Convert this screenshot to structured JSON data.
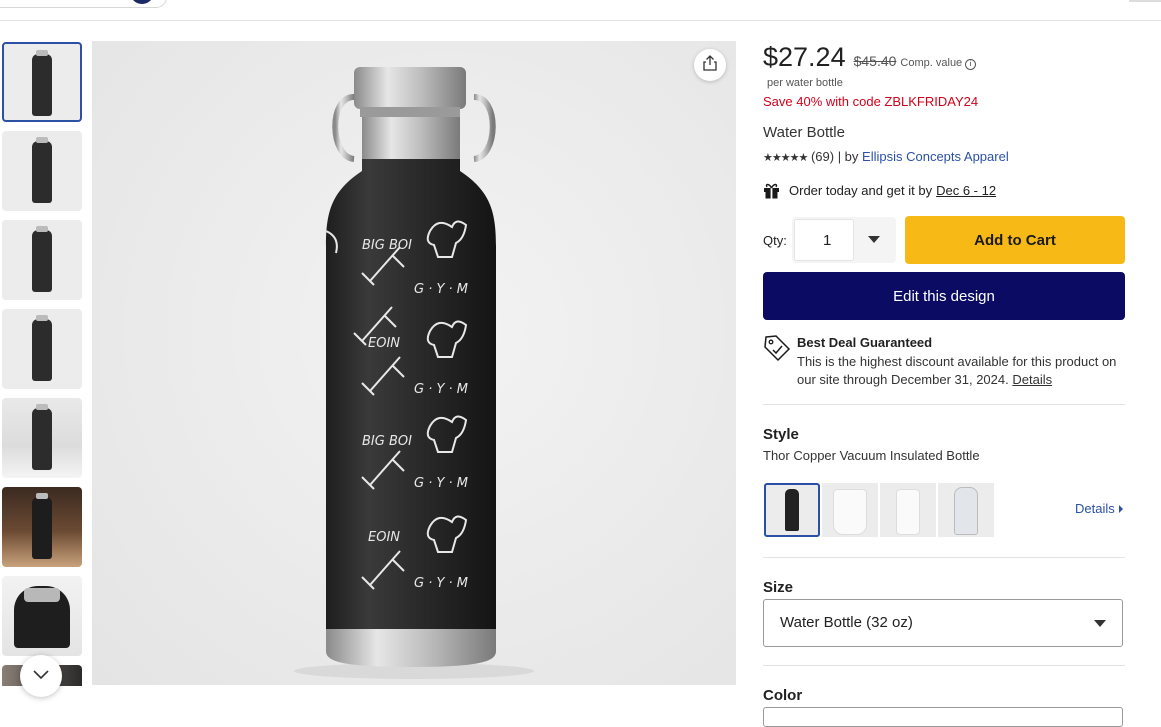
{
  "product": {
    "price": "$27.24",
    "old_price": "$45.40",
    "comp_label": "Comp. value",
    "per_unit": "per water bottle",
    "promo": "Save 40% with code ZBLKFRIDAY24",
    "title": "Water Bottle",
    "stars": "★★★★★",
    "review_count": "(69)",
    "by_label": "| by",
    "store": "Ellipsis Concepts Apparel",
    "delivery_prefix": "Order today and get it by",
    "delivery_date": "Dec 6 - 12"
  },
  "purchase": {
    "qty_label": "Qty:",
    "qty_value": "1",
    "add_to_cart": "Add to Cart",
    "edit_design": "Edit this design"
  },
  "deal": {
    "title": "Best Deal Guaranteed",
    "text": "This is the highest discount available for this product on our site through December 31, 2024.",
    "details_link": "Details"
  },
  "style": {
    "label": "Style",
    "value": "Thor Copper Vacuum Insulated Bottle",
    "details_link": "Details"
  },
  "size": {
    "label": "Size",
    "value": "Water Bottle (32 oz)"
  },
  "color": {
    "label": "Color"
  },
  "artwork": {
    "text_big": "BIG BOI",
    "text_gym": "G · Y · M",
    "text_name": "EOIN"
  },
  "colors": {
    "accent_blue": "#2b50a6",
    "cart_yellow": "#f7b916",
    "design_navy": "#0b0b63",
    "promo_red": "#d0021b",
    "bottle_black": "#2b2b2b"
  },
  "icons": [
    "share-icon",
    "info-icon",
    "gift-icon",
    "chevron-down-icon",
    "caret-down-icon",
    "price-tag-icon",
    "caret-right-icon"
  ]
}
